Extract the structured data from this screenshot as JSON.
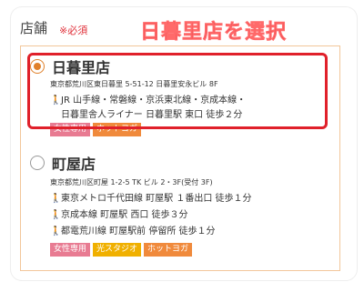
{
  "section": {
    "label": "店舗",
    "required": "※必須",
    "banner": "日暮里店を選択"
  },
  "stores": [
    {
      "name": "日暮里店",
      "selected": true,
      "address": "東京都荒川区東日暮里 5-51-12 日暮里安永ビル 8F",
      "access": [
        "JR 山手線・常磐線・京浜東北線・京成本線・",
        "日暮里舎人ライナー 日暮里駅 東口 徒歩２分"
      ],
      "tags": [
        "女性専用",
        "ホットヨガ"
      ]
    },
    {
      "name": "町屋店",
      "selected": false,
      "address": "東京都荒川区町屋 1-2-5 TK ビル 2・3F(受付 3F)",
      "access": [
        "東京メトロ千代田線 町屋駅 １番出口 徒歩１分",
        "京成本線 町屋駅 西口 徒歩３分",
        "都電荒川線 町屋駅前 停留所 徒歩１分"
      ],
      "tags": [
        "女性専用",
        "光スタジオ",
        "ホットヨガ"
      ]
    }
  ],
  "icons": {
    "walk": "walking-person-icon"
  },
  "colors": {
    "accent": "#e0802a",
    "highlight": "#e0202a",
    "tag_pink": "#e87b92",
    "tag_orange": "#f08a3c",
    "tag_yellow": "#f0b000"
  }
}
